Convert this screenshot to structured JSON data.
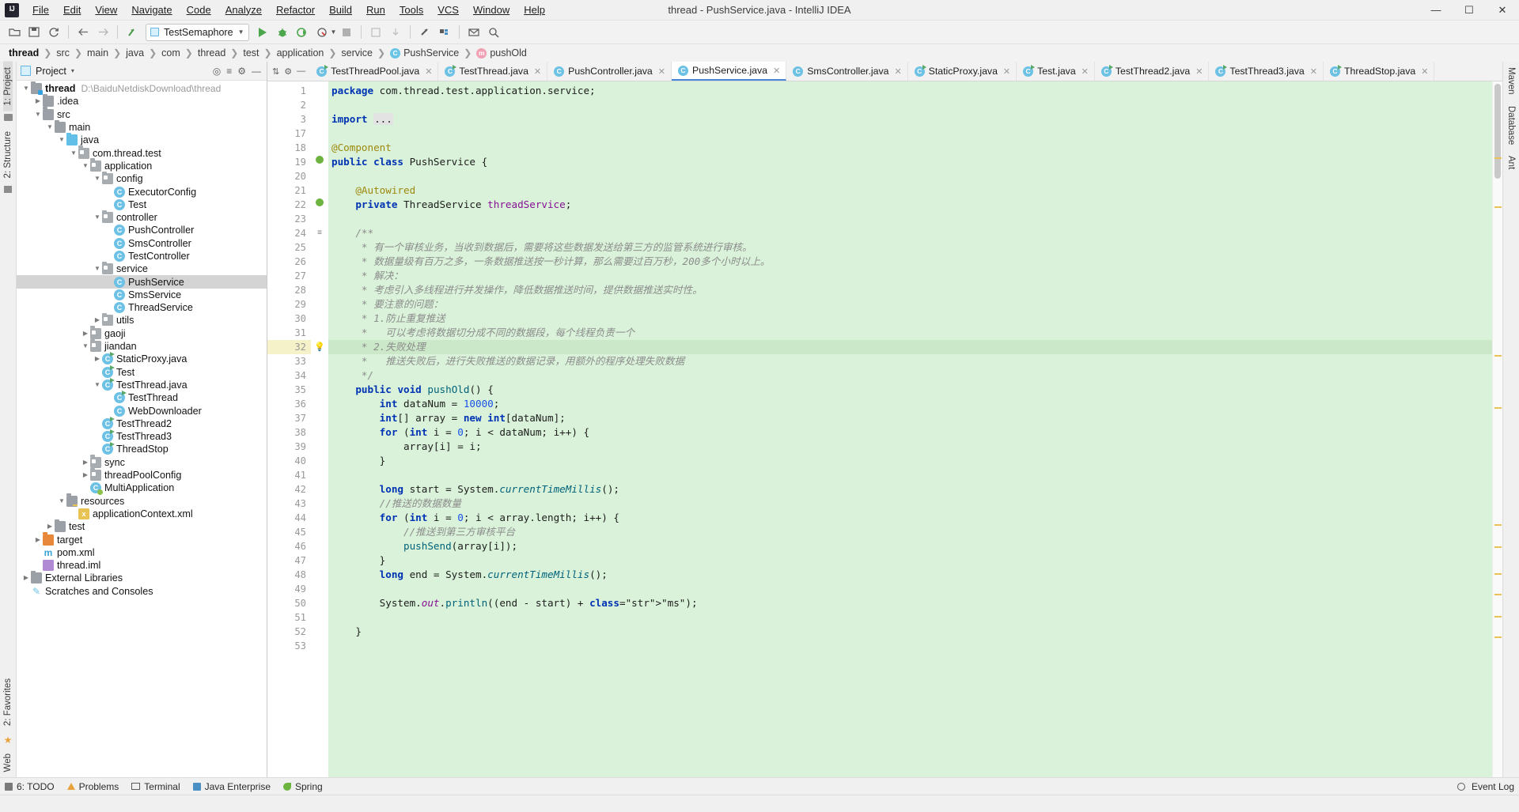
{
  "window": {
    "title": "thread - PushService.java - IntelliJ IDEA",
    "logo": "intellij-idea-logo",
    "minimize": "—",
    "maximize": "☐",
    "close": "✕"
  },
  "menu": {
    "items": [
      {
        "label": "File"
      },
      {
        "label": "Edit"
      },
      {
        "label": "View"
      },
      {
        "label": "Navigate"
      },
      {
        "label": "Code"
      },
      {
        "label": "Analyze"
      },
      {
        "label": "Refactor"
      },
      {
        "label": "Build"
      },
      {
        "label": "Run"
      },
      {
        "label": "Tools"
      },
      {
        "label": "VCS"
      },
      {
        "label": "Window"
      },
      {
        "label": "Help"
      }
    ]
  },
  "toolbar": {
    "open_icon": "folder-open-icon",
    "save_icon": "save-icon",
    "sync_icon": "refresh-icon",
    "back_icon": "arrow-left-icon",
    "forward_icon": "arrow-right-icon",
    "update_icon": "vcs-update-icon",
    "run_config_name": "TestSemaphore",
    "run_icon": "run-icon",
    "debug_icon": "debug-icon",
    "run_coverage_icon": "run-with-coverage-icon",
    "profile_icon": "profile-icon",
    "stop_icon": "stop-icon",
    "commit_icon": "vcs-commit-icon",
    "push_icon": "vcs-push-icon",
    "sdk_icon": "project-structure-icon",
    "settings_icon": "settings-icon",
    "search_icon": "search-everywhere-icon"
  },
  "breadcrumbs": {
    "items": [
      {
        "label": "thread",
        "kind": "module"
      },
      {
        "label": "src",
        "kind": "dir"
      },
      {
        "label": "main",
        "kind": "dir"
      },
      {
        "label": "java",
        "kind": "dir"
      },
      {
        "label": "com",
        "kind": "dir"
      },
      {
        "label": "thread",
        "kind": "dir"
      },
      {
        "label": "test",
        "kind": "dir"
      },
      {
        "label": "application",
        "kind": "dir"
      },
      {
        "label": "service",
        "kind": "dir"
      },
      {
        "label": "PushService",
        "kind": "class",
        "badge": "C"
      },
      {
        "label": "pushOld",
        "kind": "method",
        "badge": "m"
      }
    ],
    "separator": "❯"
  },
  "left_rail": {
    "project_label": "1: Project",
    "structure_label": "2: Structure",
    "favorites_label": "2: Favorites",
    "web_label": "Web",
    "star_icon": "star-icon",
    "folder_icon": "folder-icon",
    "grid_icon": "grid-icon"
  },
  "right_rail": {
    "maven_label": "Maven",
    "database_label": "Database",
    "ant_label": "Ant"
  },
  "project_panel": {
    "title": "Project",
    "caret": "▾",
    "icons": {
      "locate": "target-icon",
      "expand": "expand-all-icon",
      "settings": "gear-icon",
      "hide": "hide-icon"
    },
    "tree": [
      {
        "indent": 0,
        "twist": "▼",
        "icon": "module",
        "label": "thread",
        "path": "D:\\BaiduNetdiskDownload\\thread",
        "bold": true
      },
      {
        "indent": 1,
        "twist": "▶",
        "icon": "folder",
        "label": ".idea"
      },
      {
        "indent": 1,
        "twist": "▼",
        "icon": "folder",
        "label": "src"
      },
      {
        "indent": 2,
        "twist": "▼",
        "icon": "folder",
        "label": "main"
      },
      {
        "indent": 3,
        "twist": "▼",
        "icon": "folder-blue",
        "label": "java"
      },
      {
        "indent": 4,
        "twist": "▼",
        "icon": "package",
        "label": "com.thread.test"
      },
      {
        "indent": 5,
        "twist": "▼",
        "icon": "package",
        "label": "application"
      },
      {
        "indent": 6,
        "twist": "▼",
        "icon": "package",
        "label": "config"
      },
      {
        "indent": 7,
        "twist": "",
        "icon": "class",
        "label": "ExecutorConfig"
      },
      {
        "indent": 7,
        "twist": "",
        "icon": "class",
        "label": "Test"
      },
      {
        "indent": 6,
        "twist": "▼",
        "icon": "package",
        "label": "controller"
      },
      {
        "indent": 7,
        "twist": "",
        "icon": "class",
        "label": "PushController"
      },
      {
        "indent": 7,
        "twist": "",
        "icon": "class",
        "label": "SmsController"
      },
      {
        "indent": 7,
        "twist": "",
        "icon": "class",
        "label": "TestController"
      },
      {
        "indent": 6,
        "twist": "▼",
        "icon": "package",
        "label": "service"
      },
      {
        "indent": 7,
        "twist": "",
        "icon": "class",
        "label": "PushService",
        "selected": true
      },
      {
        "indent": 7,
        "twist": "",
        "icon": "class",
        "label": "SmsService"
      },
      {
        "indent": 7,
        "twist": "",
        "icon": "class",
        "label": "ThreadService"
      },
      {
        "indent": 6,
        "twist": "▶",
        "icon": "package",
        "label": "utils"
      },
      {
        "indent": 5,
        "twist": "▶",
        "icon": "package",
        "label": "gaoji"
      },
      {
        "indent": 5,
        "twist": "▼",
        "icon": "package",
        "label": "jiandan"
      },
      {
        "indent": 6,
        "twist": "▶",
        "icon": "class-runnable",
        "label": "StaticProxy.java"
      },
      {
        "indent": 6,
        "twist": "",
        "icon": "class-runnable",
        "label": "Test"
      },
      {
        "indent": 6,
        "twist": "▼",
        "icon": "class-runnable",
        "label": "TestThread.java"
      },
      {
        "indent": 7,
        "twist": "",
        "icon": "class-runnable",
        "label": "TestThread"
      },
      {
        "indent": 7,
        "twist": "",
        "icon": "class",
        "label": "WebDownloader"
      },
      {
        "indent": 6,
        "twist": "",
        "icon": "class-runnable",
        "label": "TestThread2"
      },
      {
        "indent": 6,
        "twist": "",
        "icon": "class-runnable",
        "label": "TestThread3"
      },
      {
        "indent": 6,
        "twist": "",
        "icon": "class-runnable",
        "label": "ThreadStop"
      },
      {
        "indent": 5,
        "twist": "▶",
        "icon": "package",
        "label": "sync"
      },
      {
        "indent": 5,
        "twist": "▶",
        "icon": "package",
        "label": "threadPoolConfig"
      },
      {
        "indent": 5,
        "twist": "",
        "icon": "class-spring",
        "label": "MultiApplication"
      },
      {
        "indent": 3,
        "twist": "▼",
        "icon": "resources",
        "label": "resources"
      },
      {
        "indent": 4,
        "twist": "",
        "icon": "xml",
        "label": "applicationContext.xml"
      },
      {
        "indent": 2,
        "twist": "▶",
        "icon": "folder",
        "label": "test"
      },
      {
        "indent": 1,
        "twist": "▶",
        "icon": "folder-orange",
        "label": "target"
      },
      {
        "indent": 1,
        "twist": "",
        "icon": "maven",
        "label": "pom.xml"
      },
      {
        "indent": 1,
        "twist": "",
        "icon": "iml",
        "label": "thread.iml"
      },
      {
        "indent": 0,
        "twist": "▶",
        "icon": "library",
        "label": "External Libraries"
      },
      {
        "indent": 0,
        "twist": "",
        "icon": "scratch",
        "label": "Scratches and Consoles"
      }
    ]
  },
  "editor": {
    "tabs": [
      {
        "label": "TestThreadPool.java",
        "icon": "class-runnable",
        "active": false
      },
      {
        "label": "TestThread.java",
        "icon": "class-runnable",
        "active": false
      },
      {
        "label": "PushController.java",
        "icon": "class",
        "active": false
      },
      {
        "label": "PushService.java",
        "icon": "class",
        "active": true
      },
      {
        "label": "SmsController.java",
        "icon": "class",
        "active": false
      },
      {
        "label": "StaticProxy.java",
        "icon": "class-runnable",
        "active": false
      },
      {
        "label": "Test.java",
        "icon": "class-runnable",
        "active": false
      },
      {
        "label": "TestThread2.java",
        "icon": "class-runnable",
        "active": false
      },
      {
        "label": "TestThread3.java",
        "icon": "class-runnable",
        "active": false
      },
      {
        "label": "ThreadStop.java",
        "icon": "class-runnable",
        "active": false
      }
    ],
    "tab_close_glyph": "✕",
    "tabbar_tools": {
      "sort": "sort-tabs-icon",
      "settings": "gear-icon",
      "minimize": "minimize-icon"
    },
    "line_numbers": [
      1,
      2,
      3,
      17,
      18,
      19,
      20,
      21,
      22,
      23,
      24,
      25,
      26,
      27,
      28,
      29,
      30,
      31,
      32,
      33,
      34,
      35,
      36,
      37,
      38,
      39,
      40,
      41,
      42,
      43,
      44,
      45,
      46,
      47,
      48,
      49,
      50,
      51,
      52,
      53
    ],
    "highlighted_line": 32,
    "gutter_marks": {
      "19": "spring-bean-icon",
      "22": "autowired-bean-icon",
      "24": "code-fold-icon",
      "32": "intention-bulb-icon"
    },
    "lines": [
      {
        "n": 1,
        "text": "package com.thread.test.application.service;"
      },
      {
        "n": 2,
        "text": ""
      },
      {
        "n": 3,
        "text": "import ..."
      },
      {
        "n": 17,
        "text": ""
      },
      {
        "n": 18,
        "text": "@Component"
      },
      {
        "n": 19,
        "text": "public class PushService {"
      },
      {
        "n": 20,
        "text": ""
      },
      {
        "n": 21,
        "text": "    @Autowired"
      },
      {
        "n": 22,
        "text": "    private ThreadService threadService;"
      },
      {
        "n": 23,
        "text": ""
      },
      {
        "n": 24,
        "text": "    /**"
      },
      {
        "n": 25,
        "text": "     * 有一个审核业务，当收到数据后，需要将这些数据发送给第三方的监管系统进行审核。"
      },
      {
        "n": 26,
        "text": "     * 数据量级有百万之多，一条数据推送按一秒计算，那么需要过百万秒，200多个小时以上。"
      },
      {
        "n": 27,
        "text": "     * 解决："
      },
      {
        "n": 28,
        "text": "     * 考虑引入多线程进行并发操作，降低数据推送时间，提供数据推送实时性。"
      },
      {
        "n": 29,
        "text": "     * 要注意的问题："
      },
      {
        "n": 30,
        "text": "     * 1.防止重复推送"
      },
      {
        "n": 31,
        "text": "     *   可以考虑将数据切分成不同的数据段，每个线程负责一个"
      },
      {
        "n": 32,
        "text": "     * 2.失败处理"
      },
      {
        "n": 33,
        "text": "     *   推送失败后，进行失败推送的数据记录，用额外的程序处理失败数据"
      },
      {
        "n": 34,
        "text": "     */"
      },
      {
        "n": 35,
        "text": "    public void pushOld() {"
      },
      {
        "n": 36,
        "text": "        int dataNum = 10000;"
      },
      {
        "n": 37,
        "text": "        int[] array = new int[dataNum];"
      },
      {
        "n": 38,
        "text": "        for (int i = 0; i < dataNum; i++) {"
      },
      {
        "n": 39,
        "text": "            array[i] = i;"
      },
      {
        "n": 40,
        "text": "        }"
      },
      {
        "n": 41,
        "text": ""
      },
      {
        "n": 42,
        "text": "        long start = System.currentTimeMillis();"
      },
      {
        "n": 43,
        "text": "        //推送的数据数量"
      },
      {
        "n": 44,
        "text": "        for (int i = 0; i < array.length; i++) {"
      },
      {
        "n": 45,
        "text": "            //推送到第三方审核平台"
      },
      {
        "n": 46,
        "text": "            pushSend(array[i]);"
      },
      {
        "n": 47,
        "text": "        }"
      },
      {
        "n": 48,
        "text": "        long end = System.currentTimeMillis();"
      },
      {
        "n": 49,
        "text": ""
      },
      {
        "n": 50,
        "text": "        System.out.println((end - start) + \"ms\");"
      },
      {
        "n": 51,
        "text": ""
      },
      {
        "n": 52,
        "text": "    }"
      },
      {
        "n": 53,
        "text": ""
      }
    ]
  },
  "bottom_bar": {
    "items": [
      {
        "label": "6: TODO",
        "icon": "todo-icon"
      },
      {
        "label": "Problems",
        "icon": "problems-icon"
      },
      {
        "label": "Terminal",
        "icon": "terminal-icon"
      },
      {
        "label": "Java Enterprise",
        "icon": "java-enterprise-icon"
      },
      {
        "label": "Spring",
        "icon": "spring-icon"
      }
    ],
    "event_log": "Event Log",
    "event_log_icon": "event-log-icon"
  },
  "status_bar": {
    "message": "",
    "right": ""
  },
  "colors": {
    "accent": "#4688d5",
    "editor_bg": "#d9f2d9",
    "highlight_line": "#cbe8c8",
    "selection": "#d4d4d4",
    "keyword": "#0033b3",
    "string": "#067d17",
    "number": "#1750eb",
    "comment": "#8c8c8c",
    "annotation": "#9e880d",
    "field": "#871094"
  }
}
